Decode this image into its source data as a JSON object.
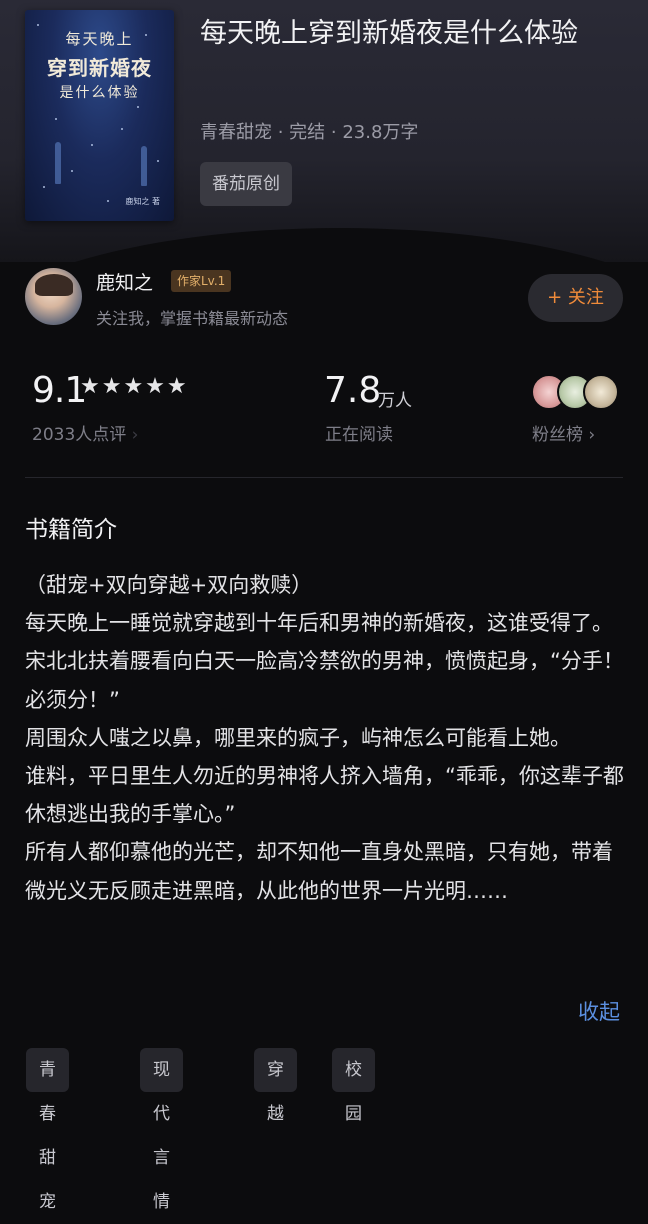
{
  "book": {
    "title": "每天晚上穿到新婚夜是什么体验",
    "meta": "青春甜宠 · 完结 · 23.8万字",
    "badge": "番茄原创",
    "cover": {
      "line1": "每天晚上",
      "line2": "穿到新婚夜",
      "line3": "是什么体验",
      "author": "鹿知之 著"
    }
  },
  "author": {
    "name": "鹿知之",
    "level": "作家Lv.1",
    "subtitle": "关注我，掌握书籍最新动态",
    "follow_label": "+ 关注"
  },
  "stats": {
    "score": "9.1",
    "stars": "★★★★★",
    "rating_count": "2033人点评",
    "rating_arrow": "›",
    "readers_value": "7.8",
    "readers_unit": "万人",
    "readers_label": "正在阅读",
    "fans_label": "粉丝榜 ›"
  },
  "intro": {
    "heading": "书籍简介",
    "paragraphs": [
      "（甜宠+双向穿越+双向救赎）",
      "每天晚上一睡觉就穿越到十年后和男神的新婚夜，这谁受得了。",
      "宋北北扶着腰看向白天一脸高冷禁欲的男神，愤愤起身，“分手！必须分！”",
      "周围众人嗤之以鼻，哪里来的疯子，屿神怎么可能看上她。",
      "谁料，平日里生人勿近的男神将人挤入墙角，“乖乖，你这辈子都休想逃出我的手掌心。”",
      "所有人都仰慕他的光芒，却不知他一直身处黑暗，只有她，带着微光义无反顾走进黑暗，从此他的世界一片光明……"
    ],
    "collapse_label": "收起"
  },
  "tags": [
    "青春甜宠",
    "现代言情",
    "穿越",
    "校园"
  ],
  "colors": {
    "accent_follow": "#f08b3a",
    "link_blue": "#5b8fe0",
    "level_gold": "#e3b06a"
  }
}
